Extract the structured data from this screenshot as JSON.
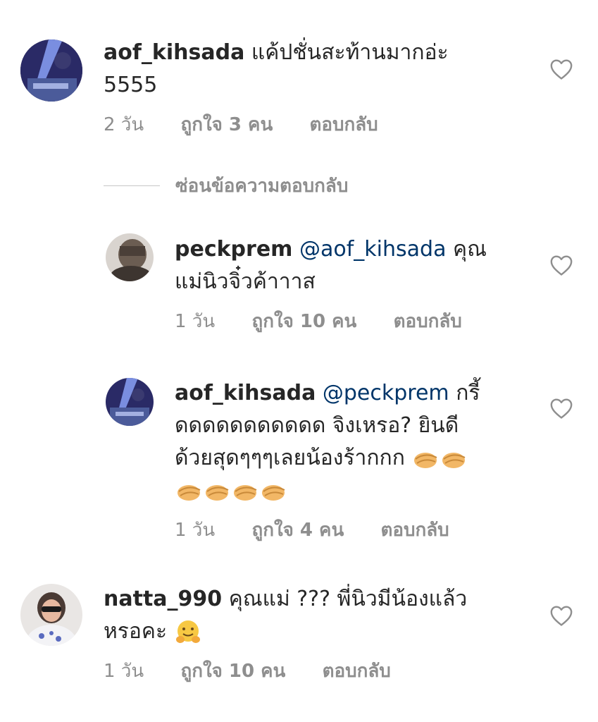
{
  "comments": [
    {
      "username": "aof_kihsada",
      "mention": "",
      "line1": "แค้ปชั่นสะท้านมากอ่ะ",
      "line2": "5555",
      "time": "2 วัน",
      "likes": "ถูกใจ 3 คน",
      "reply": "ตอบกลับ"
    },
    {
      "username": "peckprem",
      "mention": "@aof_kihsada",
      "line1": "คุณ",
      "line2": "แม่นิวจิ๋วค้าาาส",
      "time": "1 วัน",
      "likes": "ถูกใจ 10 คน",
      "reply": "ตอบกลับ"
    },
    {
      "username": "aof_kihsada",
      "mention": "@peckprem",
      "line1": "กรี้",
      "line2": "ดดดดดดดดดดด จิงเหรอ? ยินดี",
      "line3": "ด้วยสุดๆๆๆเลยน้องร้ากกก",
      "time": "1 วัน",
      "likes": "ถูกใจ 4 คน",
      "reply": "ตอบกลับ"
    },
    {
      "username": "natta_990",
      "mention": "",
      "line1": "คุณแม่ ??? พี่นิวมีน้องแล้ว",
      "line2": "หรอคะ",
      "time": "1 วัน",
      "likes": "ถูกใจ 10 คน",
      "reply": "ตอบกลับ"
    }
  ],
  "hide_replies": "ซ่อนข้อความตอบกลับ",
  "icons": {
    "heart": "heart-outline-icon",
    "clap": "clapping-hands-emoji",
    "hug": "hugging-face-emoji"
  },
  "colors": {
    "text": "#262626",
    "meta": "#8e8e8e",
    "mention": "#003569",
    "heart_stroke": "#8e8e8e"
  }
}
